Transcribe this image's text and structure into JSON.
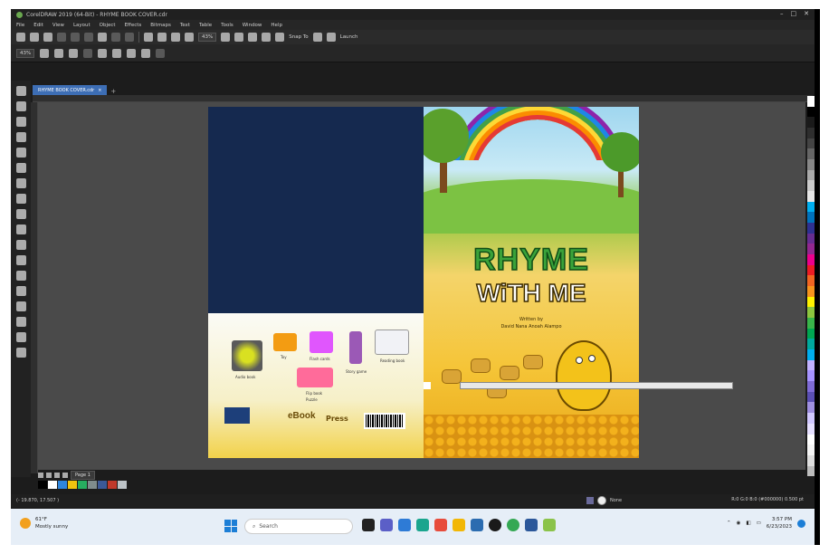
{
  "window": {
    "title": "CorelDRAW 2019 (64-Bit) - RHYME BOOK COVER.cdr",
    "controls": [
      "–",
      "□",
      "✕"
    ]
  },
  "menu": [
    "File",
    "Edit",
    "View",
    "Layout",
    "Object",
    "Effects",
    "Bitmaps",
    "Text",
    "Table",
    "Tools",
    "Window",
    "Help"
  ],
  "toolbar": {
    "zoom_value": "43%",
    "snap_label": "Snap To",
    "launch_label": "Launch"
  },
  "tabs": [
    {
      "label": "RHYME BOOK COVER.cdr"
    }
  ],
  "back_cover": {
    "product_labels": [
      "Audio book",
      "Toy",
      "Flash cards",
      "Story game",
      "Flip book",
      "Reading book",
      "Puzzle"
    ],
    "brand": "eBook",
    "brand_sub": "Press"
  },
  "front_cover": {
    "title_line1": "RHYME",
    "title_line2": "WiTH ME",
    "author_label": "Written by",
    "author_name": "David Nana Anoah Alampo"
  },
  "page_nav": {
    "page_tab": "Page 1"
  },
  "statusbar": {
    "left": "(- 19.870, 17.507 )",
    "fill_label": "None",
    "right": "R:0 G:0 B:0 (#000000) 0.500 pt"
  },
  "taskbar": {
    "weather_temp": "61°F",
    "weather_desc": "Mostly sunny",
    "search_placeholder": "Search",
    "time": "3:57 PM",
    "date": "6/23/2023"
  },
  "palette_colors": [
    "#ffffff",
    "#000000",
    "#1a1a1a",
    "#2e2e2e",
    "#444444",
    "#666666",
    "#888888",
    "#aaaaaa",
    "#cccccc",
    "#e6e6e6",
    "#00aeef",
    "#0072bc",
    "#2e3192",
    "#662d91",
    "#92278f",
    "#ec008c",
    "#ed1c24",
    "#f26522",
    "#f7941d",
    "#fff200",
    "#8dc63f",
    "#39b54a",
    "#00a651",
    "#00a99d",
    "#00aeef",
    "#c2b2ff",
    "#a693ff",
    "#7f6bd6",
    "#5b4fb4",
    "#9f8fe0",
    "#d1c8ff",
    "#e6e0ff",
    "#ffffff",
    "#f5f5f5",
    "#dedede",
    "#bcbcbc"
  ],
  "doc_palette": [
    "#000000",
    "#ffffff",
    "#2e86de",
    "#f1c40f",
    "#27ae60",
    "#7f8c8d",
    "#3b5998",
    "#c0392b",
    "#bdc3c7"
  ]
}
